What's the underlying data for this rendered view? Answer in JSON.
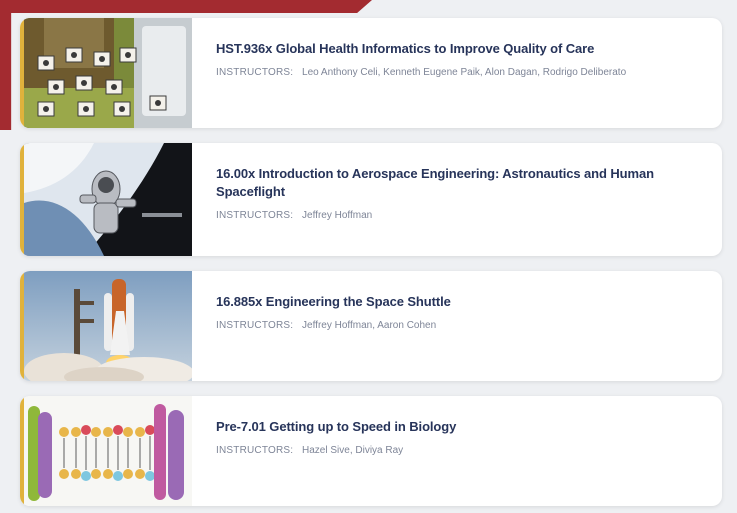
{
  "courses": [
    {
      "title": "HST.936x Global Health Informatics to Improve Quality of Care",
      "instructors_label": "INSTRUCTORS:",
      "instructors": "Leo Anthony Celi, Kenneth Eugene Paik, Alon Dagan, Rodrigo Deliberato",
      "thumbnail": "health-informatics-icons-image"
    },
    {
      "title": "16.00x Introduction to Aerospace Engineering: Astronautics and Human Spaceflight",
      "instructors_label": "INSTRUCTORS:",
      "instructors": "Jeffrey Hoffman",
      "thumbnail": "astronaut-spacewalk-image"
    },
    {
      "title": "16.885x Engineering the Space Shuttle",
      "instructors_label": "INSTRUCTORS:",
      "instructors": "Jeffrey Hoffman, Aaron Cohen",
      "thumbnail": "space-shuttle-launch-image"
    },
    {
      "title": "Pre-7.01 Getting up to Speed in Biology",
      "instructors_label": "INSTRUCTORS:",
      "instructors": "Hazel Sive, Diviya Ray",
      "thumbnail": "cell-membrane-illustration-image"
    }
  ],
  "colors": {
    "banner": "#a32b30",
    "accent": "#e0b23c",
    "title": "#27345a",
    "muted": "#7e8597"
  }
}
